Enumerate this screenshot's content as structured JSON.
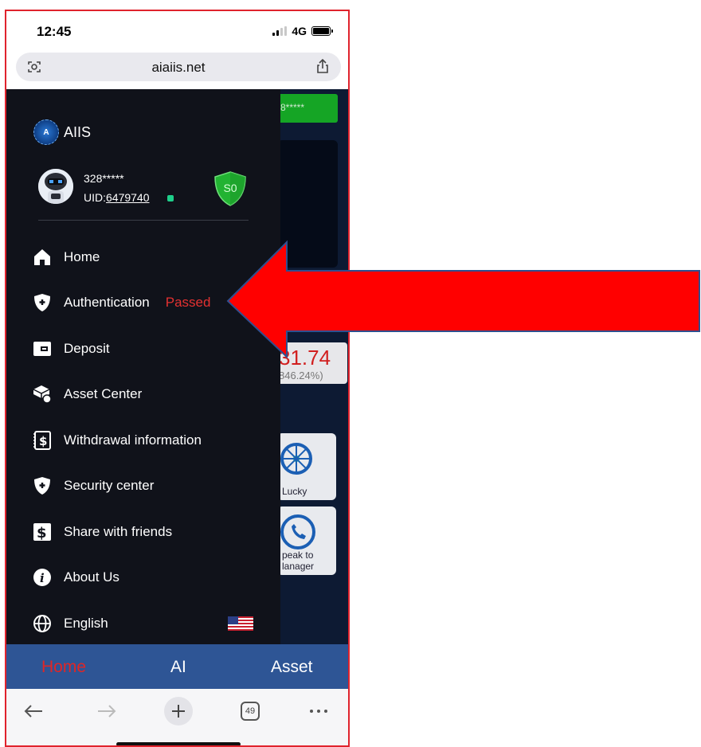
{
  "status_bar": {
    "time": "12:45",
    "network": "4G"
  },
  "browser": {
    "url": "aiaiis.net",
    "tab_count": "49",
    "left_icon": "page-scan-icon",
    "right_icon": "share-icon"
  },
  "background": {
    "green_bar_text": "8*****",
    "price": "31.74",
    "percent": "846.24%)",
    "tile_lucky": "Lucky",
    "tile_speak": "peak to\nlanager"
  },
  "drawer": {
    "brand": "AIIS",
    "brand_logo_letter": "A",
    "user": {
      "name": "328*****",
      "uid_label": "UID:",
      "uid_value": "6479740",
      "security_level": "S0"
    },
    "menu": [
      {
        "label": "Home",
        "icon": "home-icon"
      },
      {
        "label": "Authentication",
        "status": "Passed",
        "icon": "shield-icon"
      },
      {
        "label": "Deposit",
        "icon": "wallet-icon"
      },
      {
        "label": "Asset Center",
        "icon": "asset-cube-icon"
      },
      {
        "label": "Withdrawal information",
        "icon": "dollar-document-icon"
      },
      {
        "label": "Security center",
        "icon": "shield-plus-icon"
      },
      {
        "label": "Share with friends",
        "icon": "dollar-share-icon"
      },
      {
        "label": "About Us",
        "icon": "info-icon"
      },
      {
        "label": "English",
        "icon": "globe-icon",
        "flag": "us-flag-icon"
      }
    ]
  },
  "bottom_nav": {
    "items": [
      "Home",
      "AI",
      "Asset"
    ],
    "active": "Home"
  },
  "colors": {
    "drawer_bg": "#10121a",
    "nav_bg": "#2e5595",
    "accent_red": "#e02626",
    "arrow_red": "#ff0000",
    "arrow_outline": "#2f4f8f",
    "frame_border": "#e0232d"
  }
}
